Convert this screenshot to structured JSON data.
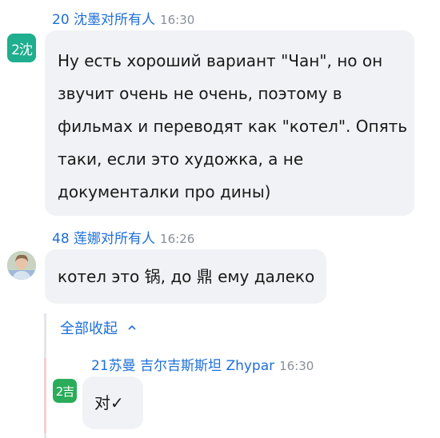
{
  "messages": [
    {
      "sender": "20 沈墨",
      "recipient": "对所有人",
      "time": "16:30",
      "avatar_text": "2沈",
      "avatar_color": "#1fae8e",
      "lines": [
        "Ну есть хороший вариант \"Чан\", но он",
        "звучит очень не очень, поэтому в",
        "фильмах и переводят как \"котел\". Опять",
        "таки, если это художка, а не",
        "документалки про дины)"
      ]
    },
    {
      "sender": "48 莲娜",
      "recipient": "对所有人",
      "time": "16:26",
      "avatar_icon": "person-photo-icon",
      "text": "котел это 锅, до 鼎 ему далеко"
    }
  ],
  "thread": {
    "collapse_label": "全部收起",
    "reply": {
      "sender": "21苏曼 吉尔吉斯斯坦 Zhypar",
      "time": "16:30",
      "avatar_text": "2吉",
      "avatar_color": "#2aac5a",
      "text": "对✓"
    }
  }
}
